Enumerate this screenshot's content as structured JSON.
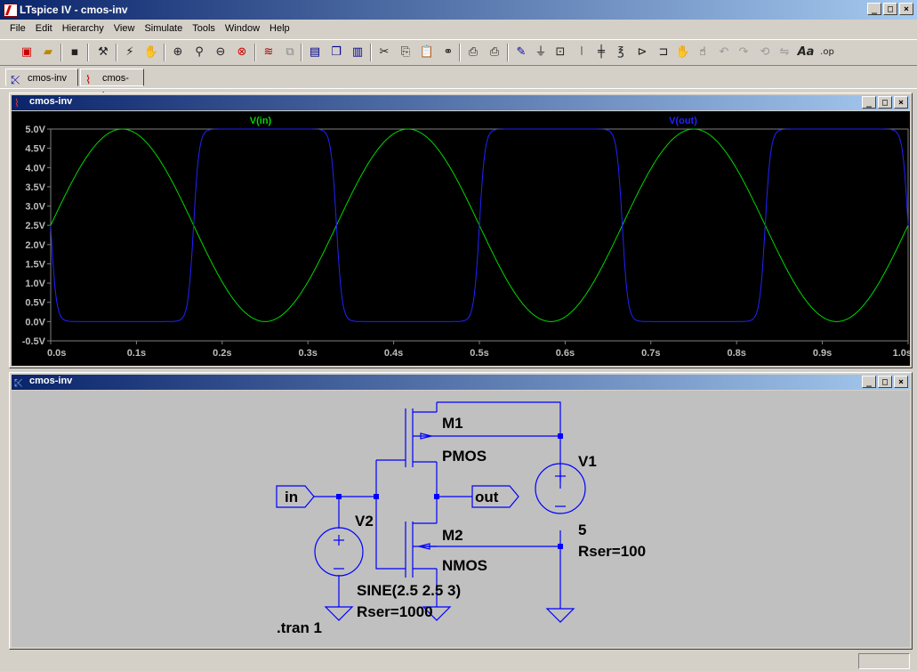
{
  "window": {
    "title": "LTspice IV - cmos-inv"
  },
  "window_buttons": [
    "_",
    "□",
    "×"
  ],
  "menu": [
    "File",
    "Edit",
    "Hierarchy",
    "View",
    "Simulate",
    "Tools",
    "Window",
    "Help"
  ],
  "toolbar_icons": [
    "new-schematic-icon",
    "open-icon",
    "save-icon",
    "control-panel-icon",
    "run-icon",
    "halt-icon",
    "zoom-in-icon",
    "zoom-out-icon",
    "zoom-area-icon",
    "zoom-cancel-icon",
    "autorange-icon",
    "add-trace-icon",
    "tile-horizontal-icon",
    "cascade-icon",
    "tile-vertical-icon",
    "cut-icon",
    "copy-icon",
    "paste-icon",
    "find-icon",
    "print-setup-icon",
    "print-icon",
    "wire-icon",
    "ground-icon",
    "label-net-icon",
    "resistor-icon",
    "capacitor-icon",
    "inductor-icon",
    "diode-icon",
    "component-icon",
    "move-icon",
    "drag-icon",
    "undo-icon",
    "redo-icon",
    "rotate-icon",
    "mirror-icon",
    "text-icon",
    "spice-directive-icon"
  ],
  "tabs": [
    {
      "label": "cmos-inv",
      "icon": "schematic-icon"
    },
    {
      "label": "cmos-inv",
      "icon": "waveform-icon"
    }
  ],
  "waveform_window": {
    "title": "cmos-inv"
  },
  "schematic_window": {
    "title": "cmos-inv"
  },
  "chart_data": {
    "type": "line",
    "x": {
      "min": 0.0,
      "max": 1.0,
      "ticks": [
        "0.0s",
        "0.1s",
        "0.2s",
        "0.3s",
        "0.4s",
        "0.5s",
        "0.6s",
        "0.7s",
        "0.8s",
        "0.9s",
        "1.0s"
      ]
    },
    "y": {
      "min": -0.5,
      "max": 5.0,
      "ticks": [
        "5.0V",
        "4.5V",
        "4.0V",
        "3.5V",
        "3.0V",
        "2.5V",
        "2.0V",
        "1.5V",
        "1.0V",
        "0.5V",
        "0.0V",
        "-0.5V"
      ]
    },
    "series": [
      {
        "name": "V(in)",
        "color": "#00d800",
        "offset": 2.5,
        "amplitude": 2.5,
        "frequency_hz": 3
      },
      {
        "name": "V(out)",
        "color": "#2222ff",
        "transfer": "cmos_inverter",
        "vdd": 5.0,
        "threshold_v": 2.5
      }
    ],
    "background": "#000000",
    "grid": false
  },
  "schematic": {
    "m1_name": "M1",
    "m1_model": "PMOS",
    "m2_name": "M2",
    "m2_model": "NMOS",
    "v1_name": "V1",
    "v1_value": "5",
    "v1_rser": "Rser=100",
    "v2_name": "V2",
    "v2_value": "SINE(2.5 2.5 3)",
    "v2_rser": "Rser=1000",
    "label_in": "in",
    "label_out": "out",
    "directive": ".tran 1"
  }
}
